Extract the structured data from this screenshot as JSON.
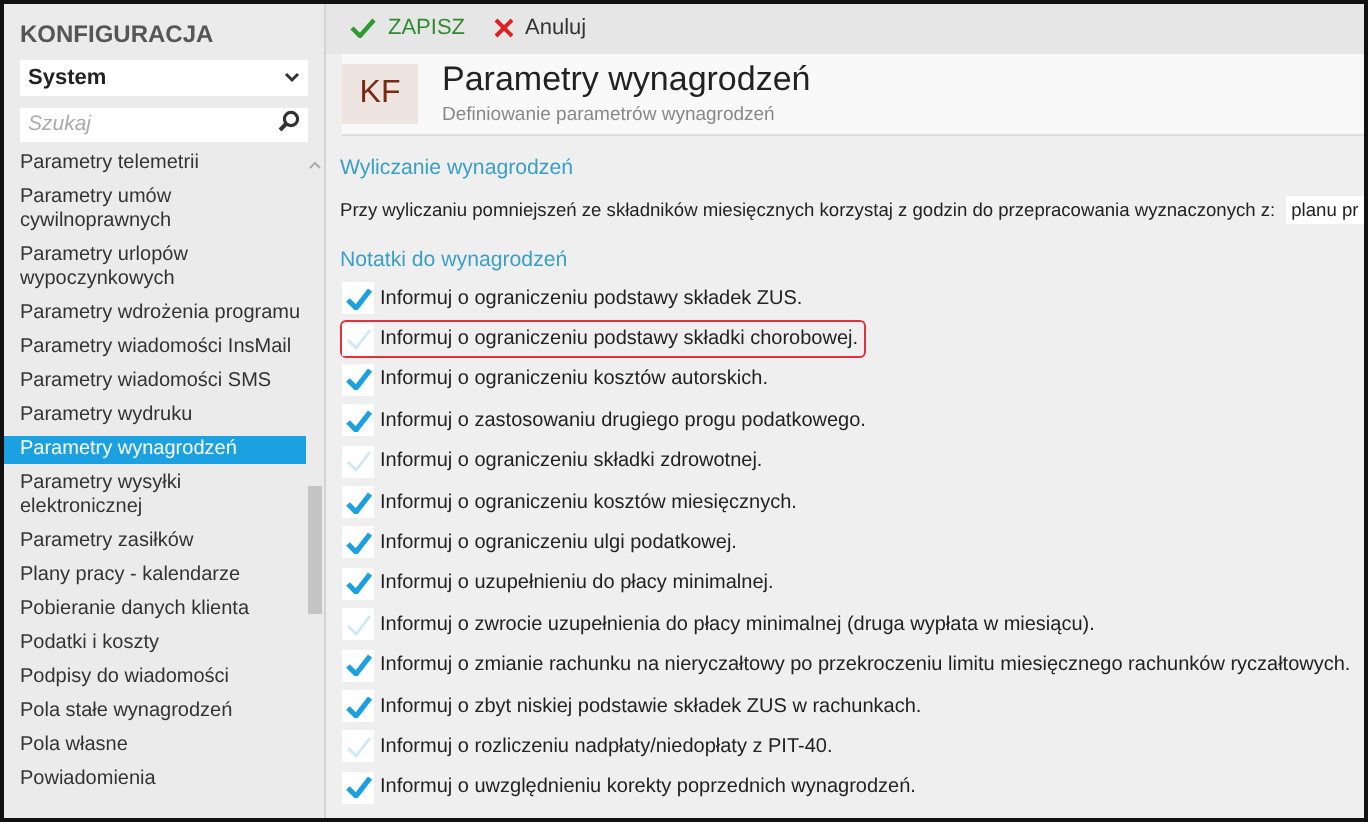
{
  "sidebar": {
    "title": "KONFIGURACJA",
    "select": "System",
    "search": {
      "placeholder": "Szukaj"
    },
    "items": [
      {
        "label": "Parametry telemetrii",
        "selected": false
      },
      {
        "label": "Parametry umów cywilnoprawnych",
        "selected": false
      },
      {
        "label": "Parametry urlopów wypoczynkowych",
        "selected": false
      },
      {
        "label": "Parametry wdrożenia programu",
        "selected": false
      },
      {
        "label": "Parametry wiadomości InsMail",
        "selected": false
      },
      {
        "label": "Parametry wiadomości SMS",
        "selected": false
      },
      {
        "label": "Parametry wydruku",
        "selected": false
      },
      {
        "label": "Parametry wynagrodzeń",
        "selected": true
      },
      {
        "label": "Parametry wysyłki elektronicznej",
        "selected": false
      },
      {
        "label": "Parametry zasiłków",
        "selected": false
      },
      {
        "label": "Plany pracy - kalendarze",
        "selected": false
      },
      {
        "label": "Pobieranie danych klienta",
        "selected": false
      },
      {
        "label": "Podatki i koszty",
        "selected": false
      },
      {
        "label": "Podpisy do wiadomości",
        "selected": false
      },
      {
        "label": "Pola stałe wynagrodzeń",
        "selected": false
      },
      {
        "label": "Pola własne",
        "selected": false
      },
      {
        "label": "Powiadomienia",
        "selected": false
      }
    ]
  },
  "toolbar": {
    "save": "ZAPISZ",
    "cancel": "Anuluj"
  },
  "header": {
    "badge": "KF",
    "title": "Parametry wynagrodzeń",
    "subtitle": "Definiowanie parametrów wynagrodzeń"
  },
  "calc": {
    "title": "Wyliczanie wynagrodzeń",
    "label": "Przy wyliczaniu pomniejszeń ze składników miesięcznych korzystaj z godzin do przepracowania wyznaczonych z:",
    "value": "planu pr"
  },
  "notes": {
    "title": "Notatki do wynagrodzeń",
    "items": [
      {
        "label": "Informuj o ograniczeniu podstawy składek ZUS.",
        "checked": true,
        "highlighted": false
      },
      {
        "label": "Informuj o ograniczeniu podstawy składki chorobowej.",
        "checked": false,
        "highlighted": true
      },
      {
        "label": "Informuj o ograniczeniu kosztów autorskich.",
        "checked": true,
        "highlighted": false
      },
      {
        "label": "Informuj o zastosowaniu drugiego progu podatkowego.",
        "checked": true,
        "highlighted": false
      },
      {
        "label": "Informuj o ograniczeniu składki zdrowotnej.",
        "checked": false,
        "highlighted": false
      },
      {
        "label": "Informuj o ograniczeniu kosztów miesięcznych.",
        "checked": true,
        "highlighted": false
      },
      {
        "label": "Informuj o ograniczeniu ulgi podatkowej.",
        "checked": true,
        "highlighted": false
      },
      {
        "label": "Informuj o uzupełnieniu do płacy minimalnej.",
        "checked": true,
        "highlighted": false
      },
      {
        "label": "Informuj o zwrocie uzupełnienia do płacy minimalnej (druga wypłata w miesiącu).",
        "checked": false,
        "highlighted": false
      },
      {
        "label": "Informuj o zmianie rachunku na nieryczałtowy po przekroczeniu limitu miesięcznego rachunków ryczałtowych.",
        "checked": true,
        "highlighted": false
      },
      {
        "label": "Informuj o zbyt niskiej podstawie składek ZUS w rachunkach.",
        "checked": true,
        "highlighted": false
      },
      {
        "label": "Informuj o rozliczeniu nadpłaty/niedopłaty z PIT-40.",
        "checked": false,
        "highlighted": false
      },
      {
        "label": "Informuj o uwzględnieniu korekty poprzednich wynagrodzeń.",
        "checked": true,
        "highlighted": false
      }
    ]
  }
}
